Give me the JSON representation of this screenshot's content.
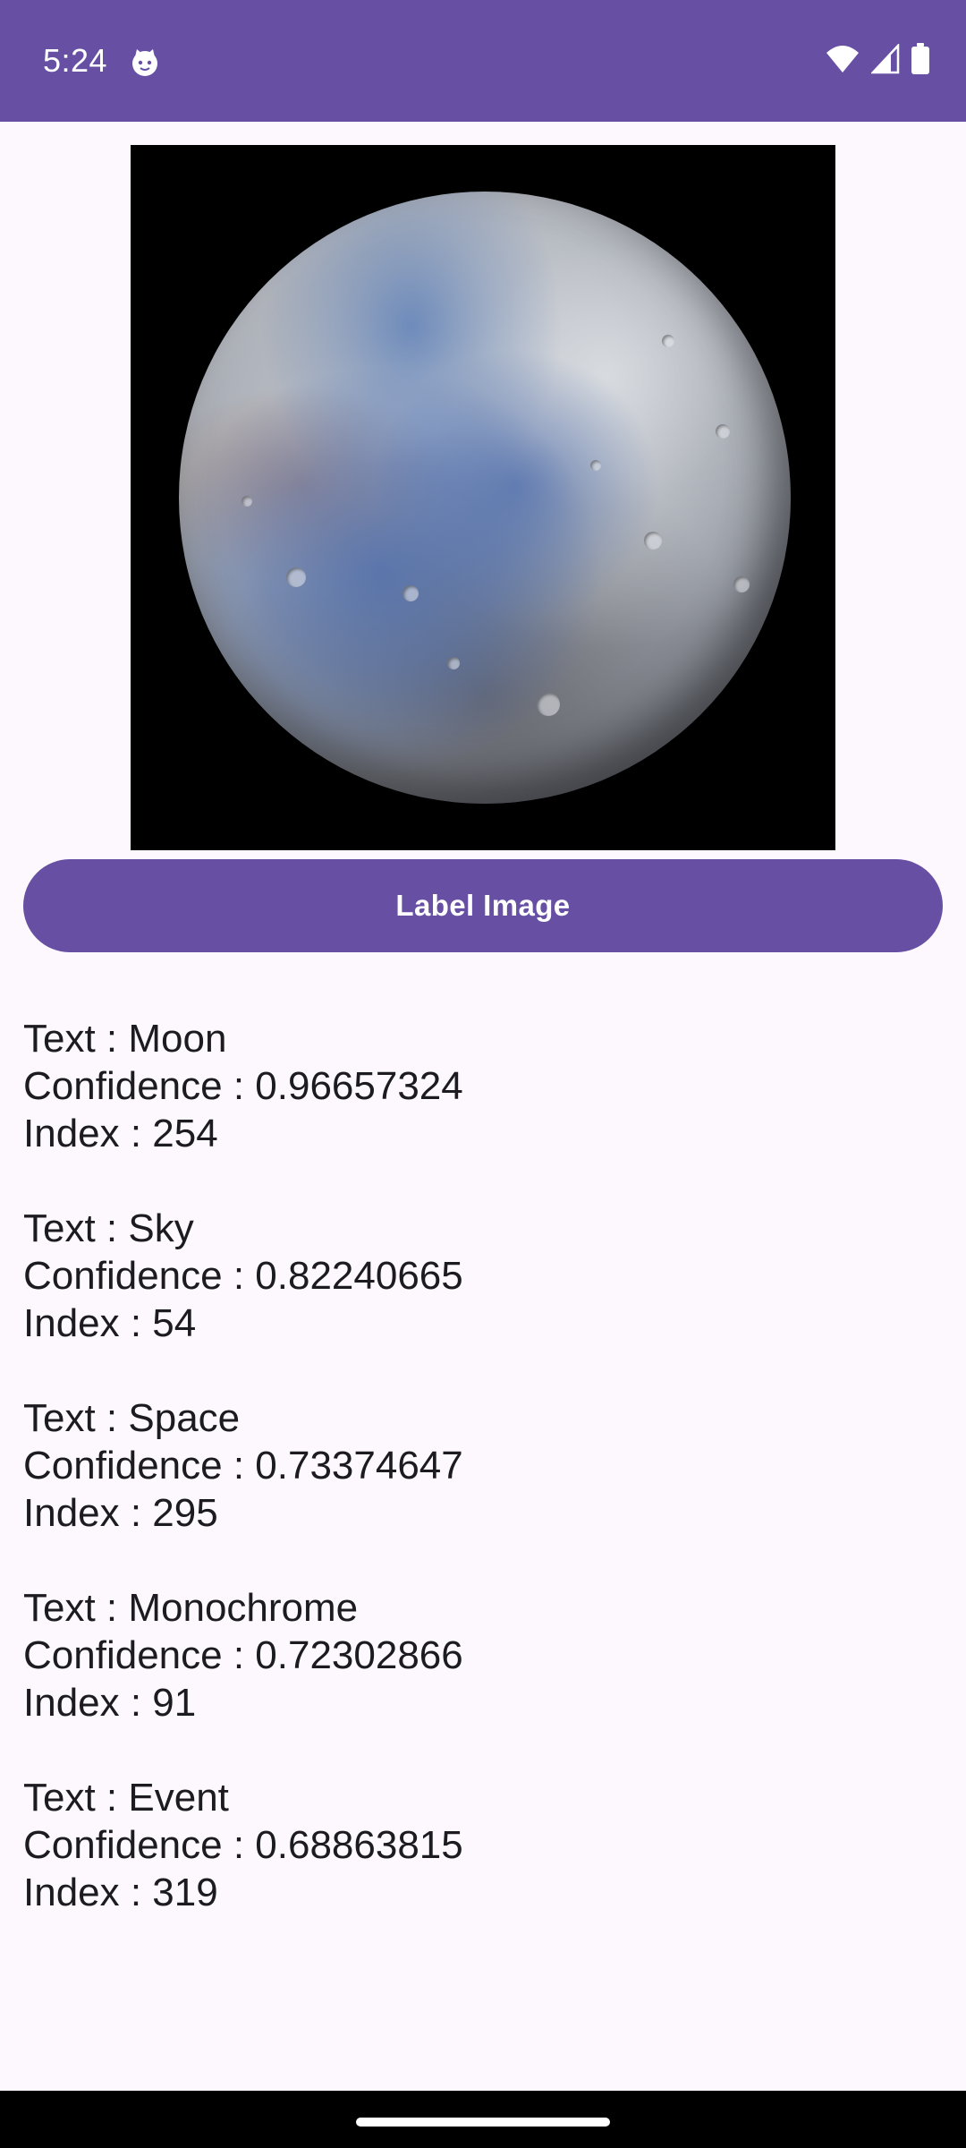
{
  "status_bar": {
    "time": "5:24",
    "background_color": "#6750A4",
    "icons": [
      "notification-cat-icon",
      "wifi-icon",
      "signal-icon",
      "battery-icon"
    ]
  },
  "image": {
    "subject": "moon-photo"
  },
  "button": {
    "label": "Label Image",
    "color": "#6750A4"
  },
  "results": [
    {
      "text": "Text : Moon",
      "confidence": "Confidence : 0.96657324",
      "index": "Index : 254"
    },
    {
      "text": "Text : Sky",
      "confidence": "Confidence : 0.82240665",
      "index": "Index : 54"
    },
    {
      "text": "Text : Space",
      "confidence": "Confidence : 0.73374647",
      "index": "Index : 295"
    },
    {
      "text": "Text : Monochrome",
      "confidence": "Confidence : 0.72302866",
      "index": "Index : 91"
    },
    {
      "text": "Text : Event",
      "confidence": "Confidence : 0.68863815",
      "index": "Index : 319"
    }
  ]
}
